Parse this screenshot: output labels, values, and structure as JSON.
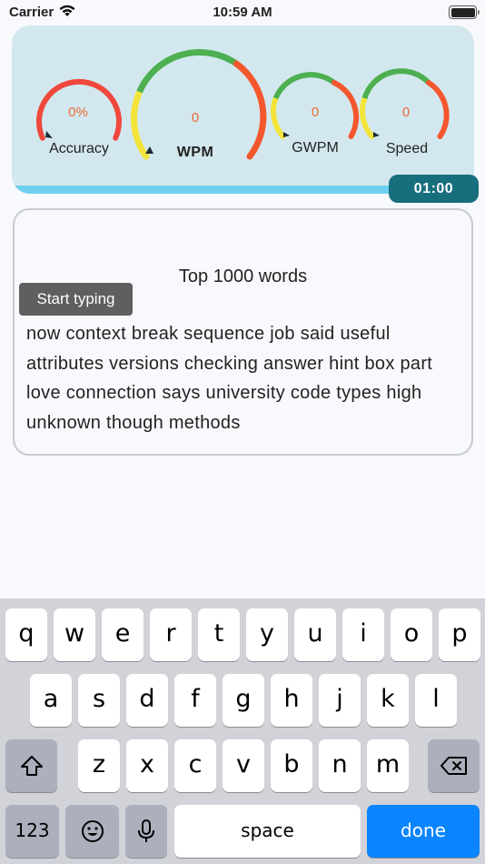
{
  "status_bar": {
    "carrier": "Carrier",
    "time": "10:59 AM"
  },
  "gauges": [
    {
      "id": "accuracy",
      "label": "Accuracy",
      "value": "0%"
    },
    {
      "id": "wpm",
      "label": "WPM",
      "value": "0"
    },
    {
      "id": "gwpm",
      "label": "GWPM",
      "value": "0"
    },
    {
      "id": "speed",
      "label": "Speed",
      "value": "0"
    }
  ],
  "progress_fraction": 0.82,
  "timer": "01:00",
  "card": {
    "title": "Top 1000 words",
    "tooltip": "Start typing",
    "words": "now context break sequence job said useful attributes versions checking answer hint box part love connection says university code types high unknown though methods"
  },
  "keyboard": {
    "row1": [
      "q",
      "w",
      "e",
      "r",
      "t",
      "y",
      "u",
      "i",
      "o",
      "p"
    ],
    "row2": [
      "a",
      "s",
      "d",
      "f",
      "g",
      "h",
      "j",
      "k",
      "l"
    ],
    "row3": [
      "z",
      "x",
      "c",
      "v",
      "b",
      "n",
      "m"
    ],
    "numbers_label": "123",
    "space_label": "space",
    "done_label": "done"
  },
  "colors": {
    "red": "#f0483c",
    "yellow": "#f2e43a",
    "green": "#4caf50",
    "orange": "#f4572e",
    "value": "#ea6a35",
    "timer_bg": "#176f7e",
    "done_blue": "#0a84ff"
  }
}
